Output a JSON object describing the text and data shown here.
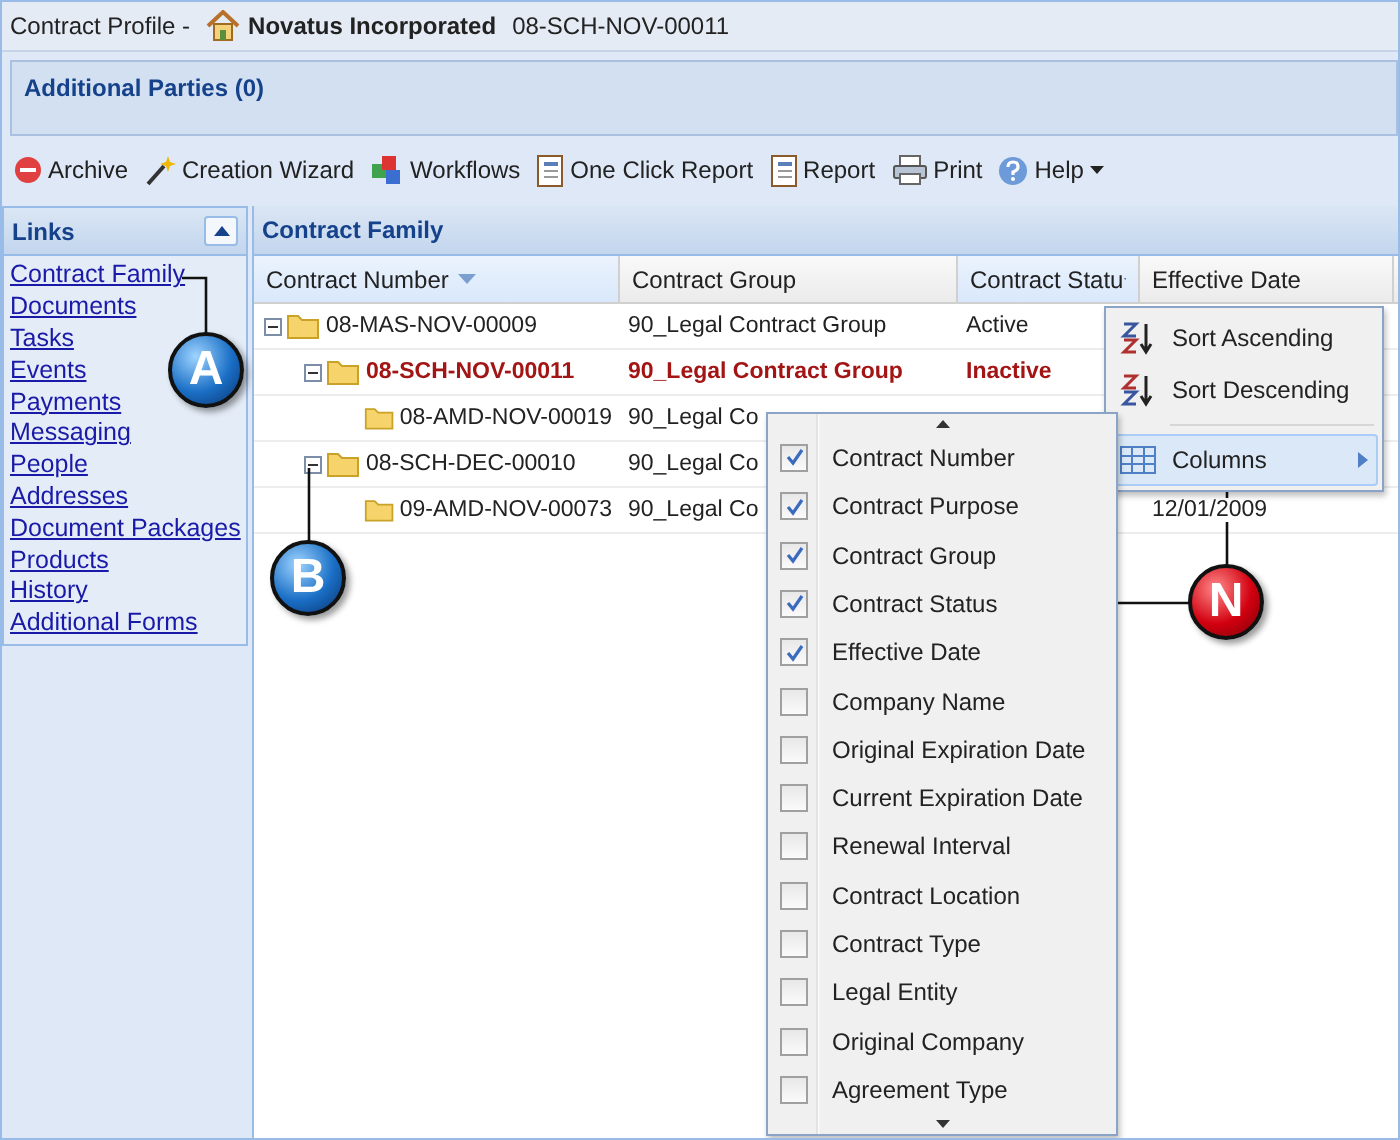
{
  "header": {
    "label": "Contract Profile -",
    "company": "Novatus Incorporated",
    "contract_id": "08-SCH-NOV-00011"
  },
  "additional_parties": {
    "title": "Additional Parties (0)"
  },
  "toolbar": [
    {
      "label": "Archive",
      "dropdown": false
    },
    {
      "label": "Creation Wizard",
      "dropdown": false
    },
    {
      "label": "Workflows",
      "dropdown": false
    },
    {
      "label": "One Click Report",
      "dropdown": false
    },
    {
      "label": "Report",
      "dropdown": false
    },
    {
      "label": "Print",
      "dropdown": false
    },
    {
      "label": "Help",
      "dropdown": true
    }
  ],
  "links": {
    "title": "Links",
    "items": [
      "Contract Family",
      "Documents",
      "Tasks",
      "Events",
      "Payments",
      "Messaging",
      "People",
      "Addresses",
      "Document Packages",
      "Products",
      "History",
      "Additional Forms"
    ]
  },
  "grid": {
    "title": "Contract Family",
    "columns": [
      {
        "label": "Contract Number",
        "sorted": true,
        "menu_open": false
      },
      {
        "label": "Contract Group",
        "sorted": false,
        "menu_open": false
      },
      {
        "label": "Contract Statu",
        "sorted": false,
        "menu_open": true
      },
      {
        "label": "Effective Date",
        "sorted": false,
        "menu_open": false
      }
    ],
    "rows": [
      {
        "number": "08-MAS-NOV-00009",
        "group": "90_Legal Contract Group",
        "status": "Active",
        "expanded": true,
        "current": false,
        "children": [
          {
            "number": "08-SCH-NOV-00011",
            "group": "90_Legal Contract Group",
            "status": "Inactive",
            "expanded": true,
            "current": true,
            "children": [
              {
                "number": "08-AMD-NOV-00019",
                "group": "90_Legal Co",
                "current": false
              }
            ]
          },
          {
            "number": "08-SCH-DEC-00010",
            "group": "90_Legal Co",
            "expanded": true,
            "current": false,
            "children": [
              {
                "number": "09-AMD-NOV-00073",
                "group": "90_Legal Co",
                "date": "12/01/2009",
                "current": false
              }
            ]
          }
        ]
      }
    ]
  },
  "column_menu": [
    {
      "label": "Sort Ascending",
      "kind": "sort-asc",
      "highlighted": false
    },
    {
      "label": "Sort Descending",
      "kind": "sort-desc",
      "highlighted": false
    },
    {
      "label": "Columns",
      "kind": "columns",
      "highlighted": true
    }
  ],
  "columns_submenu": [
    {
      "label": "Contract Number",
      "checked": true
    },
    {
      "label": "Contract Purpose",
      "checked": true
    },
    {
      "label": "Contract Group",
      "checked": true
    },
    {
      "label": "Contract Status",
      "checked": true
    },
    {
      "label": "Effective Date",
      "checked": true
    },
    {
      "label": "Company Name",
      "checked": false
    },
    {
      "label": "Original Expiration Date",
      "checked": false
    },
    {
      "label": "Current Expiration Date",
      "checked": false
    },
    {
      "label": "Renewal Interval",
      "checked": false
    },
    {
      "label": "Contract Location",
      "checked": false
    },
    {
      "label": "Contract Type",
      "checked": false
    },
    {
      "label": "Legal Entity",
      "checked": false
    },
    {
      "label": "Original Company",
      "checked": false
    },
    {
      "label": "Agreement Type",
      "checked": false
    }
  ],
  "callouts": [
    {
      "letter": "A",
      "kind": "blue"
    },
    {
      "letter": "B",
      "kind": "blue"
    },
    {
      "letter": "N",
      "kind": "red"
    }
  ]
}
